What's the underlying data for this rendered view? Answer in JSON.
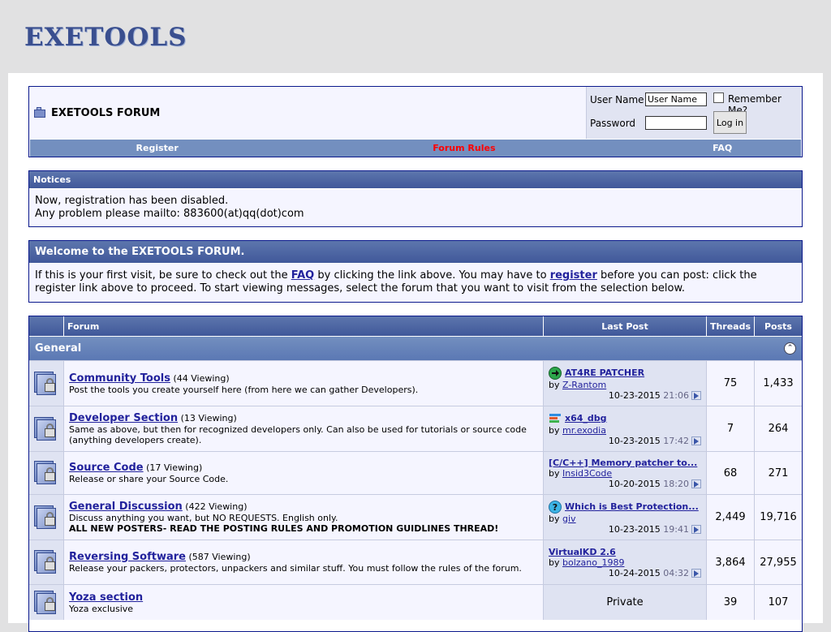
{
  "logo": {
    "text": "EXETOOLS"
  },
  "nav": {
    "title": "EXETOOLS FORUM",
    "login": {
      "username_label": "User Name",
      "username_value": "User Name",
      "password_label": "Password",
      "remember_label": "Remember Me?",
      "login_button": "Log in"
    },
    "links": [
      "Register",
      "Forum Rules",
      "FAQ"
    ],
    "forum_rules_color": "#ff0000"
  },
  "notices": {
    "header": "Notices",
    "lines": [
      "Now, registration has been disabled.",
      "Any problem please mailto: 883600(at)qq(dot)com"
    ]
  },
  "welcome": {
    "header": "Welcome to the EXETOOLS FORUM.",
    "text_1": "If this is your first visit, be sure to check out the",
    "faq_link": "FAQ",
    "text_2": "by clicking the link above. You may have to",
    "register_link": "register",
    "text_3": "before you can post: click the register link above to proceed. To start viewing messages, select the forum that you want to visit from the selection below."
  },
  "forum_table": {
    "columns": [
      "Forum",
      "Last Post",
      "Threads",
      "Posts"
    ],
    "category": "General",
    "rows": [
      {
        "title": "Community Tools",
        "viewing": "(44 Viewing)",
        "desc": "Post the tools you create yourself here (from here we can gather Developers).",
        "desc_bold": "",
        "lp_title": "AT4RE PATCHER",
        "lp_icon": "arrow-green-icon",
        "lp_by": "Z-Rantom",
        "lp_date": "10-23-2015",
        "lp_time": "21:06",
        "threads": "75",
        "posts": "1,433"
      },
      {
        "title": "Developer Section",
        "viewing": "(13 Viewing)",
        "desc": "Same as above, but then for recognized developers only. Can also be used for tutorials or source code (anything developers create).",
        "desc_bold": "",
        "lp_title": "x64_dbg",
        "lp_icon": "lines-icon",
        "lp_by": "mr.exodia",
        "lp_date": "10-23-2015",
        "lp_time": "17:42",
        "threads": "7",
        "posts": "264"
      },
      {
        "title": "Source Code",
        "viewing": "(17 Viewing)",
        "desc": "Release or share your Source Code.",
        "desc_bold": "",
        "lp_title": "[C/C++] Memory patcher to...",
        "lp_icon": "",
        "lp_by": "Insid3Code",
        "lp_date": "10-20-2015",
        "lp_time": "18:20",
        "threads": "68",
        "posts": "271"
      },
      {
        "title": "General Discussion",
        "viewing": "(422 Viewing)",
        "desc": "Discuss anything you want, but NO REQUESTS. English only.",
        "desc_bold": "ALL NEW POSTERS- READ THE POSTING RULES AND PROMOTION GUIDLINES THREAD!",
        "lp_title": "Which is Best Protection...",
        "lp_icon": "question-icon",
        "lp_by": "giv",
        "lp_date": "10-23-2015",
        "lp_time": "19:41",
        "threads": "2,449",
        "posts": "19,716"
      },
      {
        "title": "Reversing Software",
        "viewing": "(587 Viewing)",
        "desc": "Release your packers, protectors, unpackers and similar stuff. You must follow the rules of the forum.",
        "desc_bold": "",
        "lp_title": "VirtualKD 2.6",
        "lp_icon": "",
        "lp_by": "bolzano_1989",
        "lp_date": "10-24-2015",
        "lp_time": "04:32",
        "threads": "3,864",
        "posts": "27,955"
      },
      {
        "title": "Yoza section",
        "viewing": "",
        "desc": "Yoza exclusive",
        "desc_bold": "",
        "private": "Private",
        "threads": "39",
        "posts": "107"
      }
    ]
  }
}
